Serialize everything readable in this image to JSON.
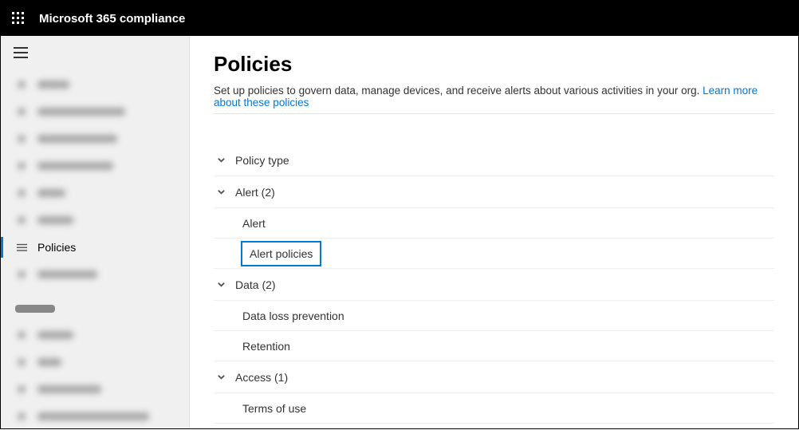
{
  "header": {
    "appTitle": "Microsoft 365 compliance"
  },
  "sidebar": {
    "active": "Policies"
  },
  "page": {
    "title": "Policies",
    "description": "Set up policies to govern data, manage devices, and receive alerts about various activities in your org. ",
    "linkText": "Learn more about these policies"
  },
  "policy": {
    "typeLabel": "Policy type",
    "groups": [
      {
        "label": "Alert (2)",
        "items": [
          "Alert",
          "Alert policies"
        ],
        "selected": "Alert policies"
      },
      {
        "label": "Data (2)",
        "items": [
          "Data loss prevention",
          "Retention"
        ],
        "selected": null
      },
      {
        "label": "Access (1)",
        "items": [
          "Terms of use"
        ],
        "selected": null
      }
    ]
  }
}
